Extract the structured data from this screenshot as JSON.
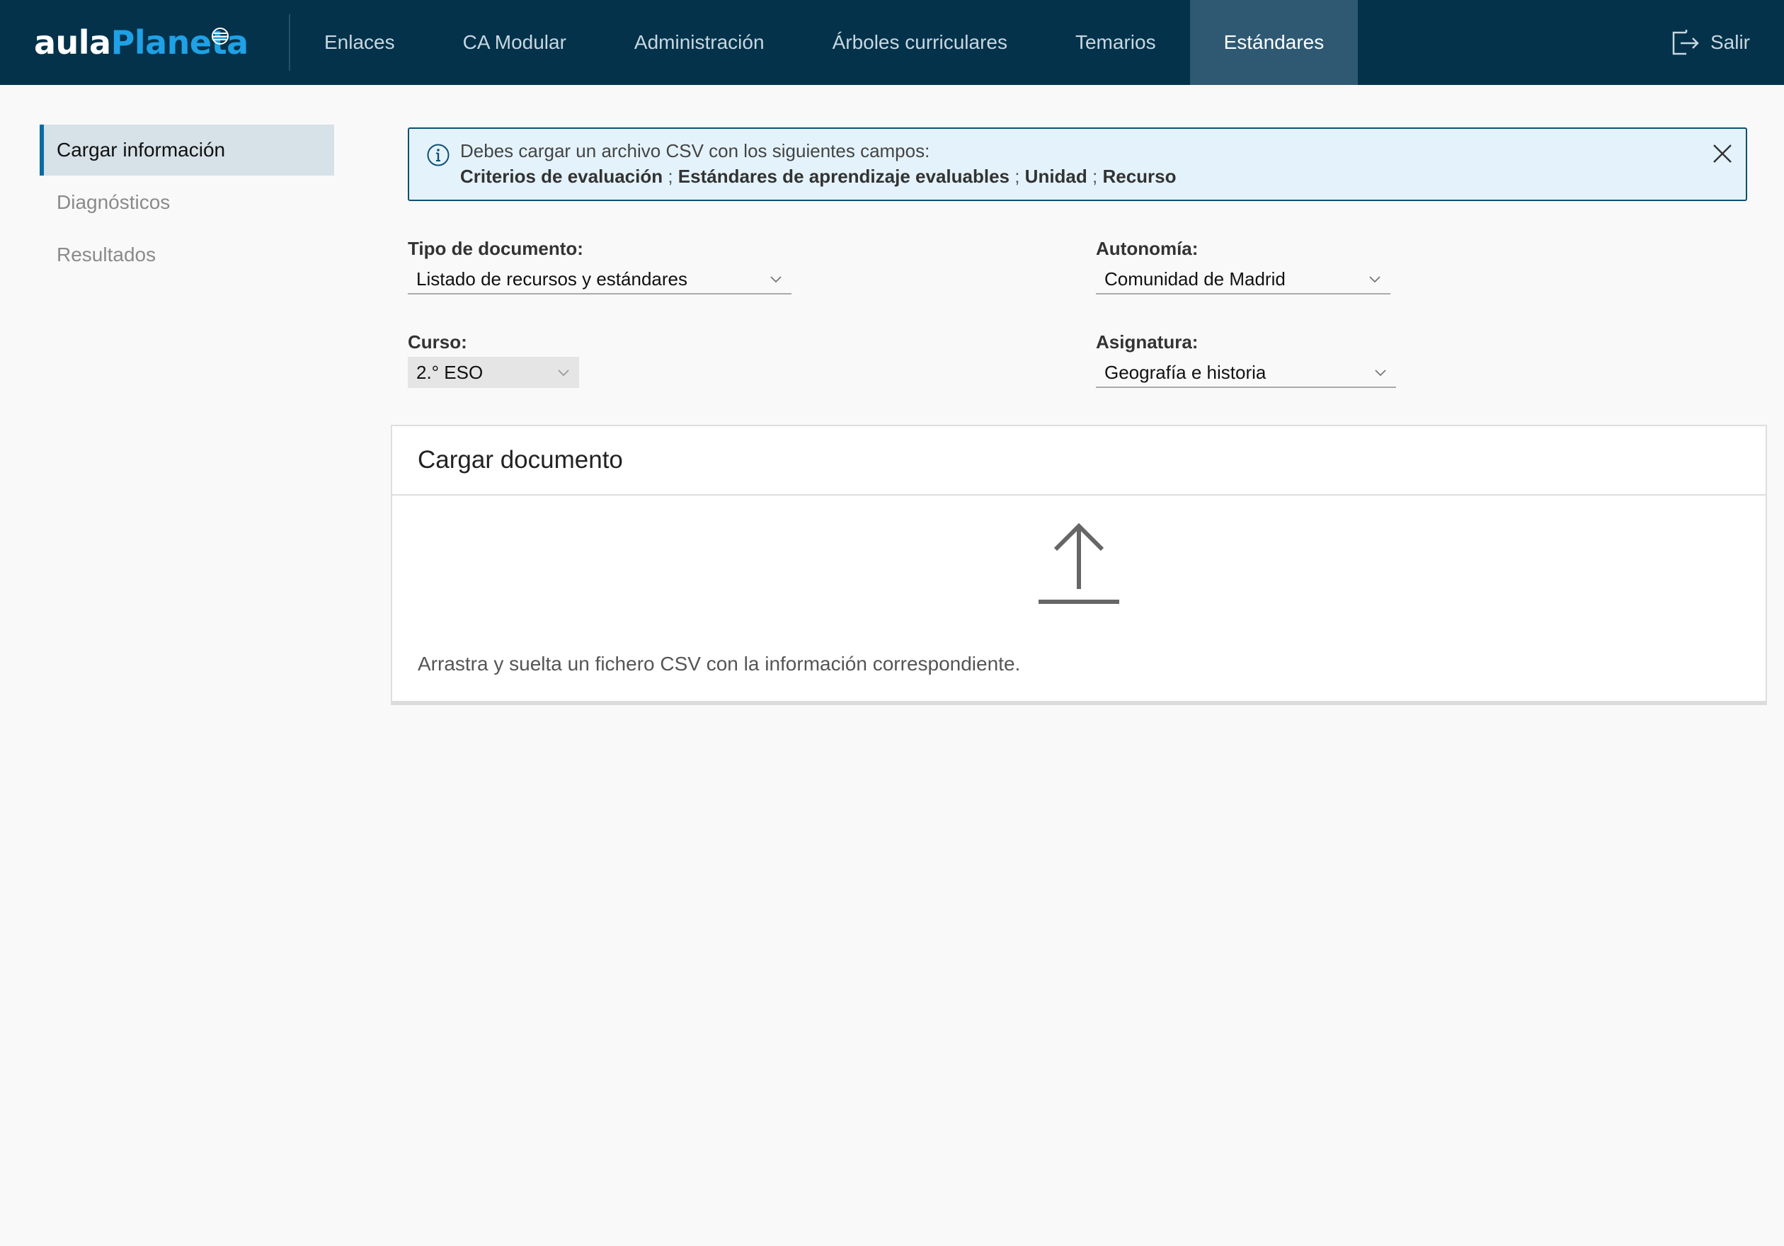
{
  "header": {
    "logo_part1": "aula",
    "logo_part2": "Planeta",
    "nav": [
      {
        "label": "Enlaces",
        "active": false
      },
      {
        "label": "CA Modular",
        "active": false
      },
      {
        "label": "Administración",
        "active": false
      },
      {
        "label": "Árboles curriculares",
        "active": false
      },
      {
        "label": "Temarios",
        "active": false
      },
      {
        "label": "Estándares",
        "active": true
      }
    ],
    "logout_label": "Salir"
  },
  "sidebar": {
    "items": [
      {
        "label": "Cargar información",
        "active": true
      },
      {
        "label": "Diagnósticos",
        "active": false
      },
      {
        "label": "Resultados",
        "active": false
      }
    ]
  },
  "alert": {
    "text": "Debes cargar un archivo CSV con los siguientes campos:",
    "fields": [
      "Criterios de evaluación",
      "Estándares de aprendizaje evaluables",
      "Unidad",
      "Recurso"
    ],
    "separator": " ; "
  },
  "form": {
    "tipo_documento": {
      "label": "Tipo de documento:",
      "value": "Listado de recursos y estándares"
    },
    "autonomia": {
      "label": "Autonomía:",
      "value": "Comunidad de Madrid"
    },
    "curso": {
      "label": "Curso:",
      "value": "2.° ESO"
    },
    "asignatura": {
      "label": "Asignatura:",
      "value": "Geografía e historia"
    }
  },
  "upload": {
    "title": "Cargar documento",
    "instructions": "Arrastra y suelta un fichero CSV con la información correspondiente."
  },
  "colors": {
    "topbar": "#03324a",
    "active_tab": "#2f5972",
    "brand_blue": "#1ea1e6",
    "alert_bg": "#e4f3fb",
    "sidebar_active": "#d6e1e8"
  },
  "icons": {
    "logo": "globe-icon",
    "logout": "logout-icon",
    "alert": "info-icon",
    "close": "close-icon",
    "dropdown": "chevron-down-icon",
    "upload": "upload-icon"
  }
}
